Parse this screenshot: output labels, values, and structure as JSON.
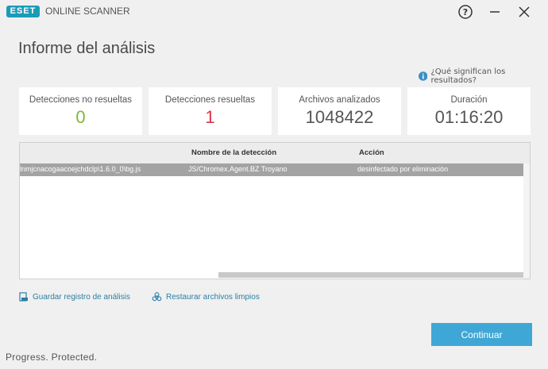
{
  "window": {
    "logo_text": "ESET",
    "app_name": "ONLINE SCANNER"
  },
  "page": {
    "title": "Informe del análisis",
    "help_link": "¿Qué significan los resultados?"
  },
  "stats": [
    {
      "label": "Detecciones no resueltas",
      "value": "0",
      "color": "#7cb83a"
    },
    {
      "label": "Detecciones resueltas",
      "value": "1",
      "color": "#d9364a"
    },
    {
      "label": "Archivos analizados",
      "value": "1048422",
      "color": "#555555"
    },
    {
      "label": "Duración",
      "value": "01:16:20",
      "color": "#555555"
    }
  ],
  "table": {
    "columns": [
      "",
      "Nombre de la detección",
      "Acción"
    ],
    "rows": [
      {
        "file": "lnmjcnacogaacoejchdclp\\1.6.0_0\\bg.js",
        "detection": "JS/Chromex.Agent.BZ Troyano",
        "action": "desinfectado por eliminación"
      }
    ]
  },
  "actions": {
    "save_log": "Guardar registro de análisis",
    "restore_clean": "Restaurar archivos limpios"
  },
  "buttons": {
    "continue": "Continuar"
  },
  "footer": {
    "tagline": "Progress. Protected."
  }
}
